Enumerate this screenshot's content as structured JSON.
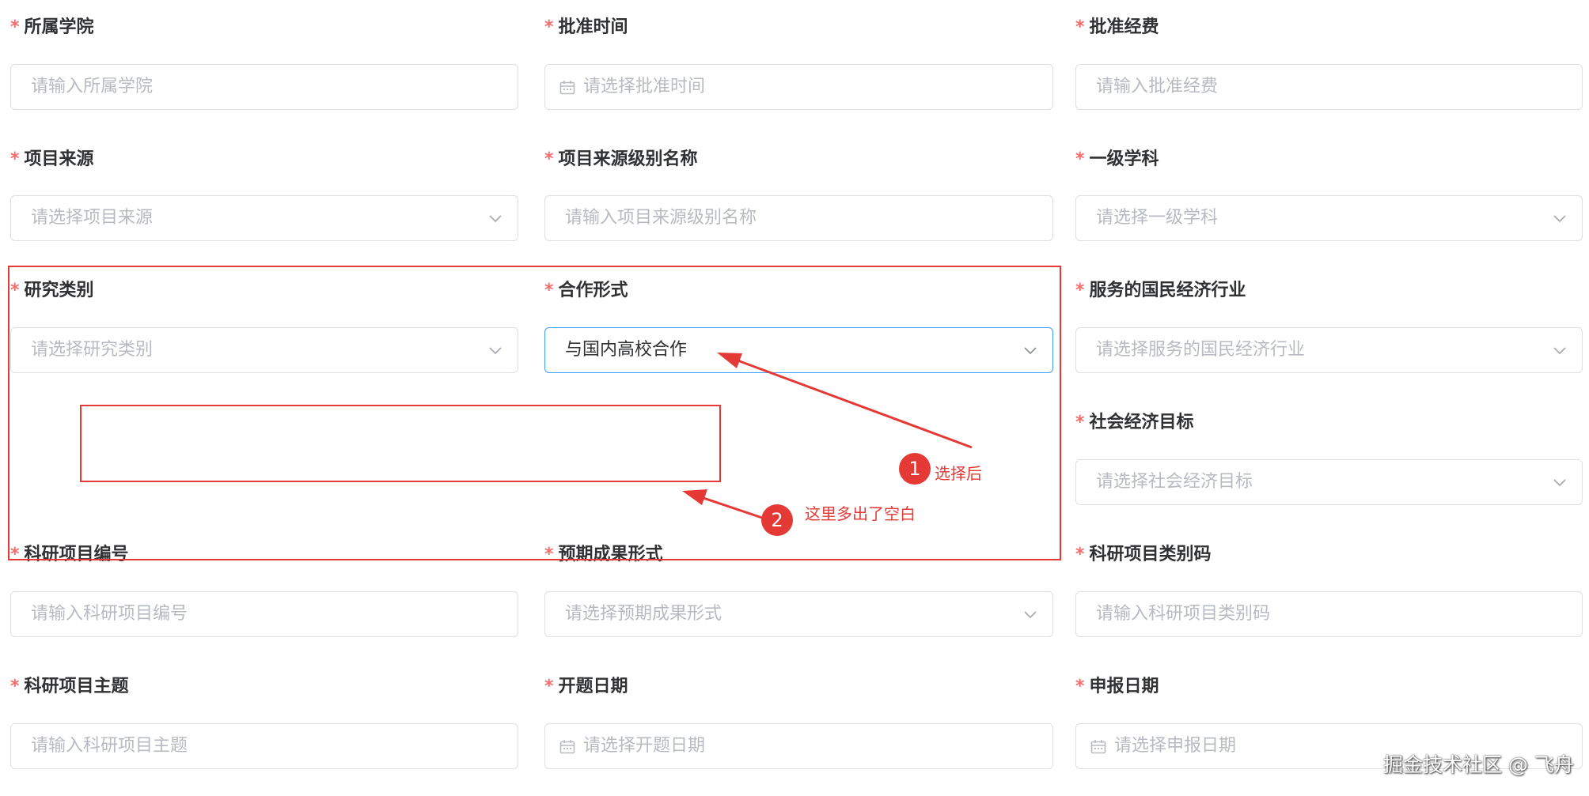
{
  "form": {
    "college": {
      "label": "所属学院",
      "placeholder": "请输入所属学院"
    },
    "approve_time": {
      "label": "批准时间",
      "placeholder": "请选择批准时间"
    },
    "approve_fund": {
      "label": "批准经费",
      "placeholder": "请输入批准经费"
    },
    "project_source": {
      "label": "项目来源",
      "placeholder": "请选择项目来源"
    },
    "source_level_name": {
      "label": "项目来源级别名称",
      "placeholder": "请输入项目来源级别名称"
    },
    "primary_discipline": {
      "label": "一级学科",
      "placeholder": "请选择一级学科"
    },
    "research_category": {
      "label": "研究类别",
      "placeholder": "请选择研究类别"
    },
    "cooperation_form": {
      "label": "合作形式",
      "value": "与国内高校合作"
    },
    "national_economy_industry": {
      "label": "服务的国民经济行业",
      "placeholder": "请选择服务的国民经济行业"
    },
    "socioeconomic_goal": {
      "label": "社会经济目标",
      "placeholder": "请选择社会经济目标"
    },
    "project_number": {
      "label": "科研项目编号",
      "placeholder": "请输入科研项目编号"
    },
    "expected_outcome": {
      "label": "预期成果形式",
      "placeholder": "请选择预期成果形式"
    },
    "project_category_code": {
      "label": "科研项目类别码",
      "placeholder": "请输入科研项目类别码"
    },
    "project_subject": {
      "label": "科研项目主题",
      "placeholder": "请输入科研项目主题"
    },
    "opening_date": {
      "label": "开题日期",
      "placeholder": "请选择开题日期"
    },
    "application_date": {
      "label": "申报日期",
      "placeholder": "请选择申报日期"
    }
  },
  "required_mark": "*",
  "annotations": {
    "badge1": "1",
    "text1": "选择后",
    "badge2": "2",
    "text2": "这里多出了空白",
    "color": "#e53935"
  },
  "watermark": "掘金技术社区 @ 飞舟",
  "icons": {
    "select": "chevron-down-icon",
    "date": "calendar-icon"
  }
}
